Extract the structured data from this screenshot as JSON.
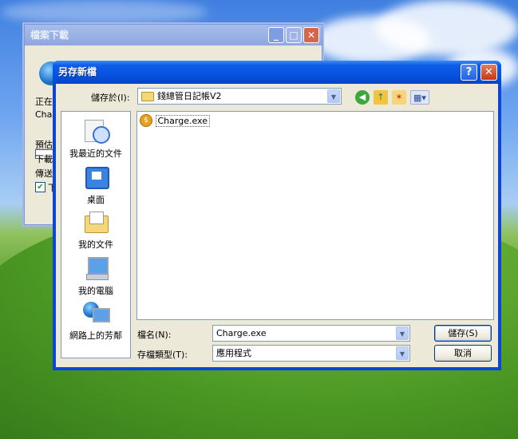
{
  "background_dialog": {
    "title": "檔案下載",
    "lines": [
      "正在",
      "Char",
      "預估",
      "下載",
      "傳送"
    ],
    "checkbox_text": "下"
  },
  "dialog": {
    "title": "另存新檔",
    "help_glyph": "?",
    "close_glyph": "✕"
  },
  "save_in": {
    "label": "儲存於(I):",
    "value": "錢總管日記帳V2"
  },
  "places": [
    {
      "label": "我最近的文件",
      "icon": "recent-documents-icon"
    },
    {
      "label": "桌面",
      "icon": "desktop-icon"
    },
    {
      "label": "我的文件",
      "icon": "my-documents-icon"
    },
    {
      "label": "我的電腦",
      "icon": "my-computer-icon"
    },
    {
      "label": "網路上的芳鄰",
      "icon": "network-places-icon"
    }
  ],
  "files": [
    {
      "name": "Charge.exe",
      "icon": "exe-file-icon"
    }
  ],
  "filename": {
    "label": "檔名(N):",
    "value": "Charge.exe"
  },
  "filetype": {
    "label": "存檔類型(T):",
    "value": "應用程式"
  },
  "buttons": {
    "save": "儲存(S)",
    "cancel": "取消"
  }
}
